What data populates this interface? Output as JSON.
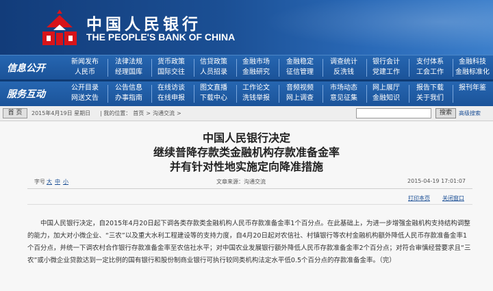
{
  "header": {
    "bank_name_cn": "中国人民银行",
    "bank_name_en": "THE PEOPLE'S BANK OF CHINA",
    "colors": {
      "banner": "#1b4f94",
      "nav": "#1d5aa3",
      "logo_red": "#d7141a"
    }
  },
  "nav": {
    "row1_label": "信息公开",
    "row1": [
      [
        "新闻发布",
        "人民币"
      ],
      [
        "法律法规",
        "经理国库"
      ],
      [
        "货币政策",
        "国际交往"
      ],
      [
        "信贷政策",
        "人员招录"
      ],
      [
        "金融市场",
        "金融研究"
      ],
      [
        "金融稳定",
        "征信管理"
      ],
      [
        "调查统计",
        "反洗钱"
      ],
      [
        "银行会计",
        "党建工作"
      ],
      [
        "支付体系",
        "工会工作"
      ],
      [
        "金融科技",
        "金融标准化"
      ]
    ],
    "row2_label": "服务互动",
    "row2": [
      [
        "公开目录",
        "网送文告"
      ],
      [
        "公告信息",
        "办事指南"
      ],
      [
        "在线访谈",
        "在线申报"
      ],
      [
        "图文直播",
        "下载中心"
      ],
      [
        "工作论文",
        "洗钱举报"
      ],
      [
        "音频视频",
        "网上调查"
      ],
      [
        "市场动态",
        "意见征集"
      ],
      [
        "网上展厅",
        "金融知识"
      ],
      [
        "报告下载",
        "关于我们"
      ],
      [
        "报刊年鉴",
        ""
      ]
    ]
  },
  "toolbar": {
    "home_label": "首 页",
    "date": "2015年4月19日 星期日",
    "crumb_prefix": "| 我的位置：",
    "crumb_home": "首页",
    "crumb_sep": ">",
    "crumb_section": "沟通交流",
    "crumb_end": ">",
    "search_button": "搜索",
    "advanced_search": "高级搜索"
  },
  "article": {
    "title_line1": "中国人民银行决定",
    "title_line2": "继续普降存款类金融机构存款准备金率",
    "title_line3": "并有针对性地实施定向降准措施",
    "font_size_label": "字号",
    "font_large": "大",
    "font_medium": "中",
    "font_small": "小",
    "source": "文章来源：沟通交流",
    "publish_time": "2015-04-19 17:01:07",
    "print_link": "打印本页",
    "close_link": "关闭窗口",
    "body": "中国人民银行决定，自2015年4月20日起下调各类存款类金融机构人民币存款准备金率1个百分点。在此基础上，为进一步增强金融机构支持结构调整的能力，加大对小微企业、“三农”以及重大水利工程建设等的支持力度，自4月20日起对农信社、村镇银行等农村金融机构额外降低人民币存款准备金率1个百分点，并统一下调农村合作银行存款准备金率至农信社水平；对中国农业发展银行额外降低人民币存款准备金率2个百分点；对符合审慎经营要求且“三农”或小微企业贷款达到一定比例的国有银行和股份制商业银行可执行较同类机构法定水平低0.5个百分点的存款准备金率。（完）"
  }
}
